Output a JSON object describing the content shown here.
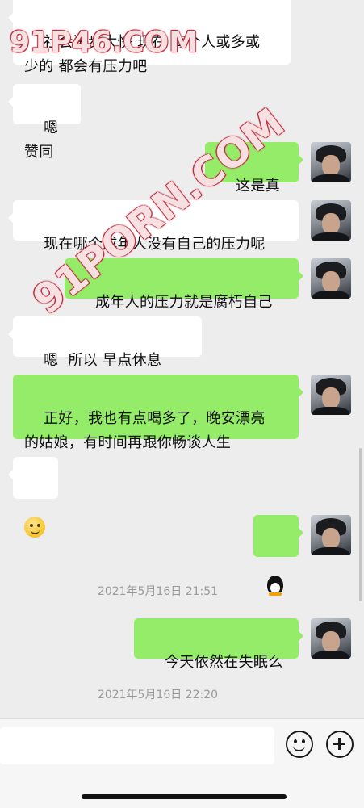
{
  "messages": [
    {
      "side": "left",
      "text": "社会进步太快 现在 每个人或多或\n少的 都会有压力吧"
    },
    {
      "side": "left",
      "text": "嗯 赞同"
    },
    {
      "side": "right",
      "text": "这是真的"
    },
    {
      "side": "left",
      "text": "现在哪个成年人没有自己的压力呢"
    },
    {
      "side": "right",
      "text": "成年人的压力就是腐朽自己"
    },
    {
      "side": "left",
      "text": "嗯  所以 早点休息",
      "emoji": "smile-emoji"
    },
    {
      "side": "right",
      "text": "正好，我也有点喝多了，晚安漂亮\n的姑娘，有时间再跟你畅谈人生"
    },
    {
      "side": "left",
      "text": "",
      "emoji": "smile-emoji"
    },
    {
      "side": "right",
      "text": "",
      "emoji": "qq-penguin-emoji"
    },
    {
      "side": "right",
      "text": "今天依然在失眠么"
    }
  ],
  "timestamps": [
    "2021年5月16日 21:51",
    "2021年5月16日 22:20"
  ],
  "watermark": {
    "top": "91P46.COM",
    "diagonal": "91PORN.COM"
  },
  "input_bar": {
    "value": "",
    "emoji_icon": "emoji-button-icon",
    "plus_icon": "plus-button-icon"
  },
  "colors": {
    "background": "#ededed",
    "incoming": "#ffffff",
    "outgoing": "#95ec69"
  }
}
